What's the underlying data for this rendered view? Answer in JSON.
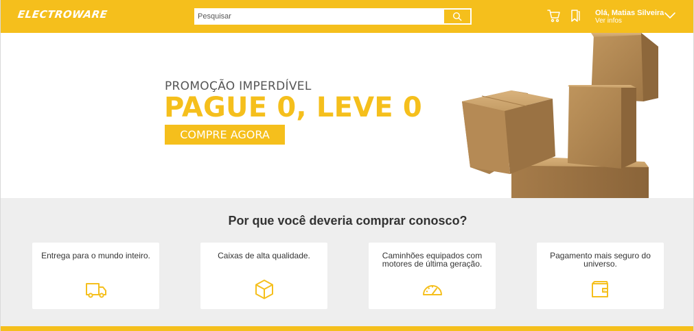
{
  "header": {
    "logo": "ELECTROWARE",
    "search_placeholder": "Pesquisar",
    "user_greeting": "Olá, Matias Silveira",
    "user_info_link": "Ver infos",
    "icons": [
      "cart-icon",
      "bookmark-icon",
      "search-icon",
      "chevron-down-icon"
    ]
  },
  "hero": {
    "subtitle": "PROMOÇÃO IMPERDÍVEL",
    "title": "PAGUE 0, LEVE 0",
    "cta": "COMPRE AGORA"
  },
  "why": {
    "title": "Por que você deveria comprar conosco?",
    "cards": [
      {
        "text": "Entrega para o mundo inteiro.",
        "icon": "truck-icon"
      },
      {
        "text": "Caixas de alta qualidade.",
        "icon": "box-icon"
      },
      {
        "text": "Caminhões equipados com motores de última geração.",
        "icon": "speedometer-icon"
      },
      {
        "text": "Pagamento mais seguro do universo.",
        "icon": "wallet-icon"
      }
    ]
  },
  "colors": {
    "accent": "#f5bf1c",
    "section_bg": "#eeeeee",
    "text": "#333333"
  }
}
